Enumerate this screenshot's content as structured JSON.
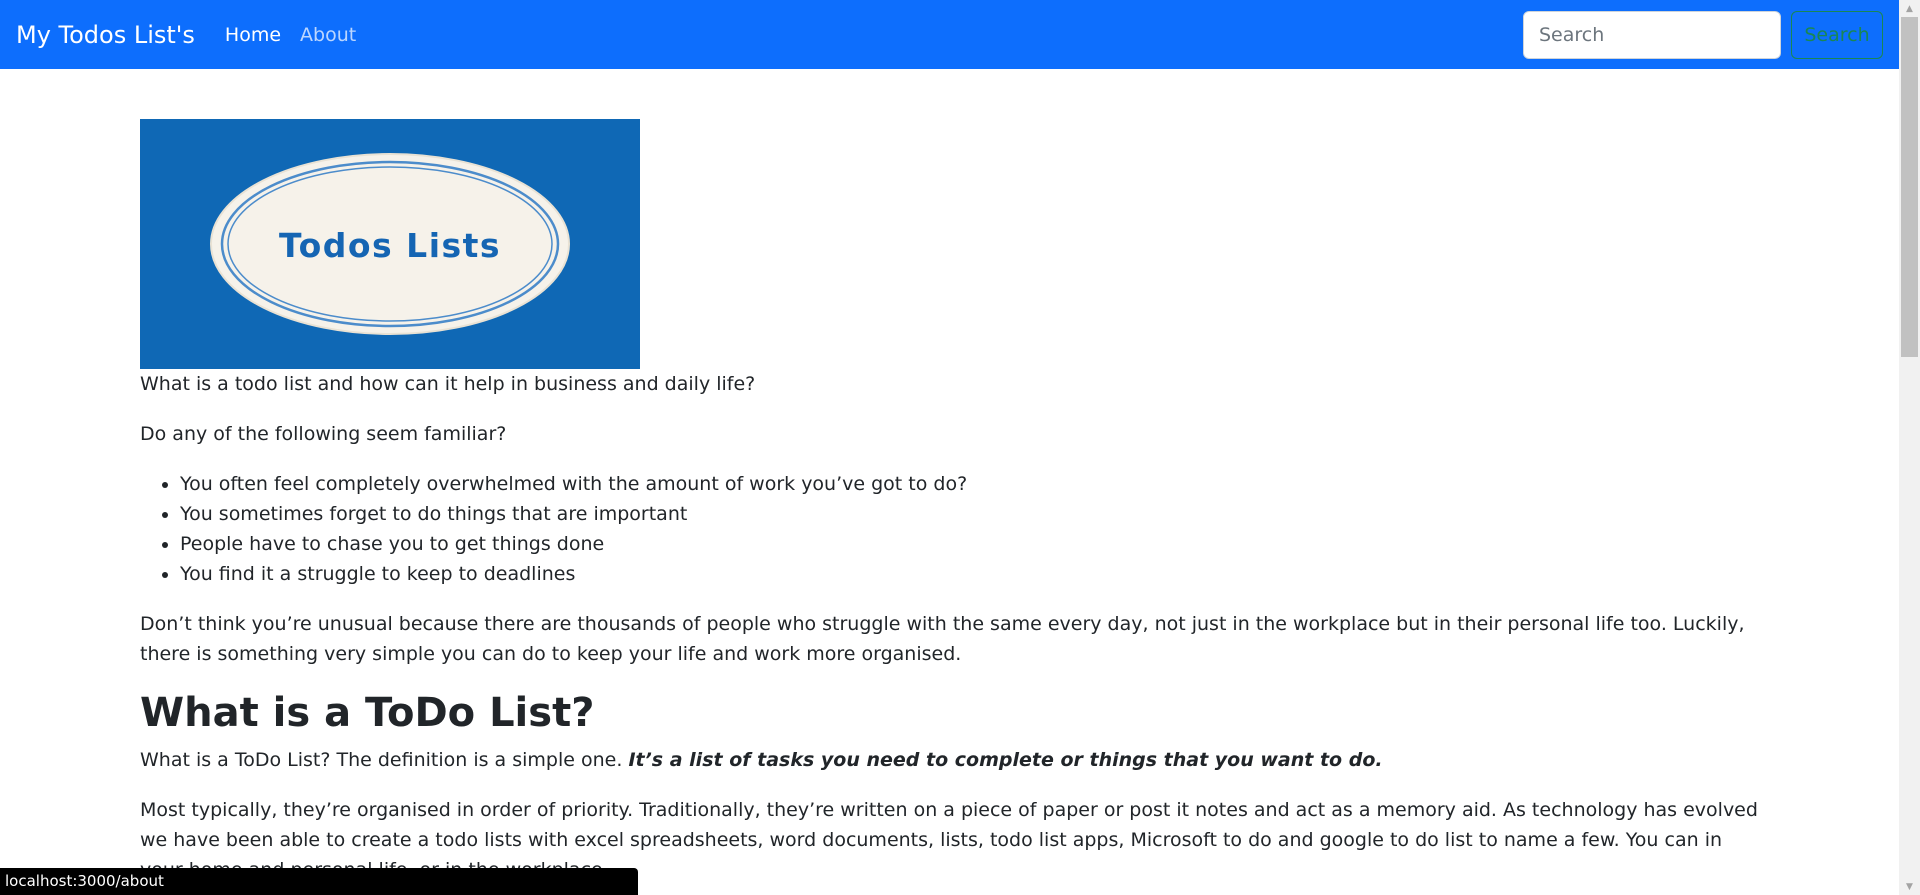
{
  "navbar": {
    "brand": "My Todos List's",
    "links": [
      {
        "label": "Home"
      },
      {
        "label": "About"
      }
    ],
    "search_placeholder": "Search",
    "search_button": "Search",
    "colors": {
      "background": "#0d6efd",
      "search_button": "#198754"
    }
  },
  "logo": {
    "text": "Todos Lists",
    "background": "#0f68b5"
  },
  "content": {
    "intro": "What is a todo list and how can it help in business and daily life?",
    "question": "Do any of the following seem familiar?",
    "bullets": [
      "You often feel completely overwhelmed with the amount of work you’ve got to do?",
      "You sometimes forget to do things that are important",
      "People have to chase you to get things done",
      "You find it a struggle to keep to deadlines"
    ],
    "paragraph1": "Don’t think you’re unusual because there are thousands of people who struggle with the same every day, not just in the workplace but in their personal life too. Luckily, there is something very simple you can do to keep your life and work more organised.",
    "heading": "What is a ToDo List?",
    "definition_prefix": "What is a ToDo List? The definition is a simple one. ",
    "definition_emph": "It’s a list of tasks you need to complete or things that you want to do.",
    "paragraph2": "Most typically, they’re organised in order of priority. Traditionally, they’re written on a piece of paper or post it notes and act as a memory aid. As technology has evolved we have been able to create a todo lists with excel spreadsheets, word documents, lists, todo list apps, Microsoft to do and google to do list to name a few. You can in your home and personal life, or in the workplace."
  },
  "status_bar": {
    "url": "localhost:3000/about"
  }
}
